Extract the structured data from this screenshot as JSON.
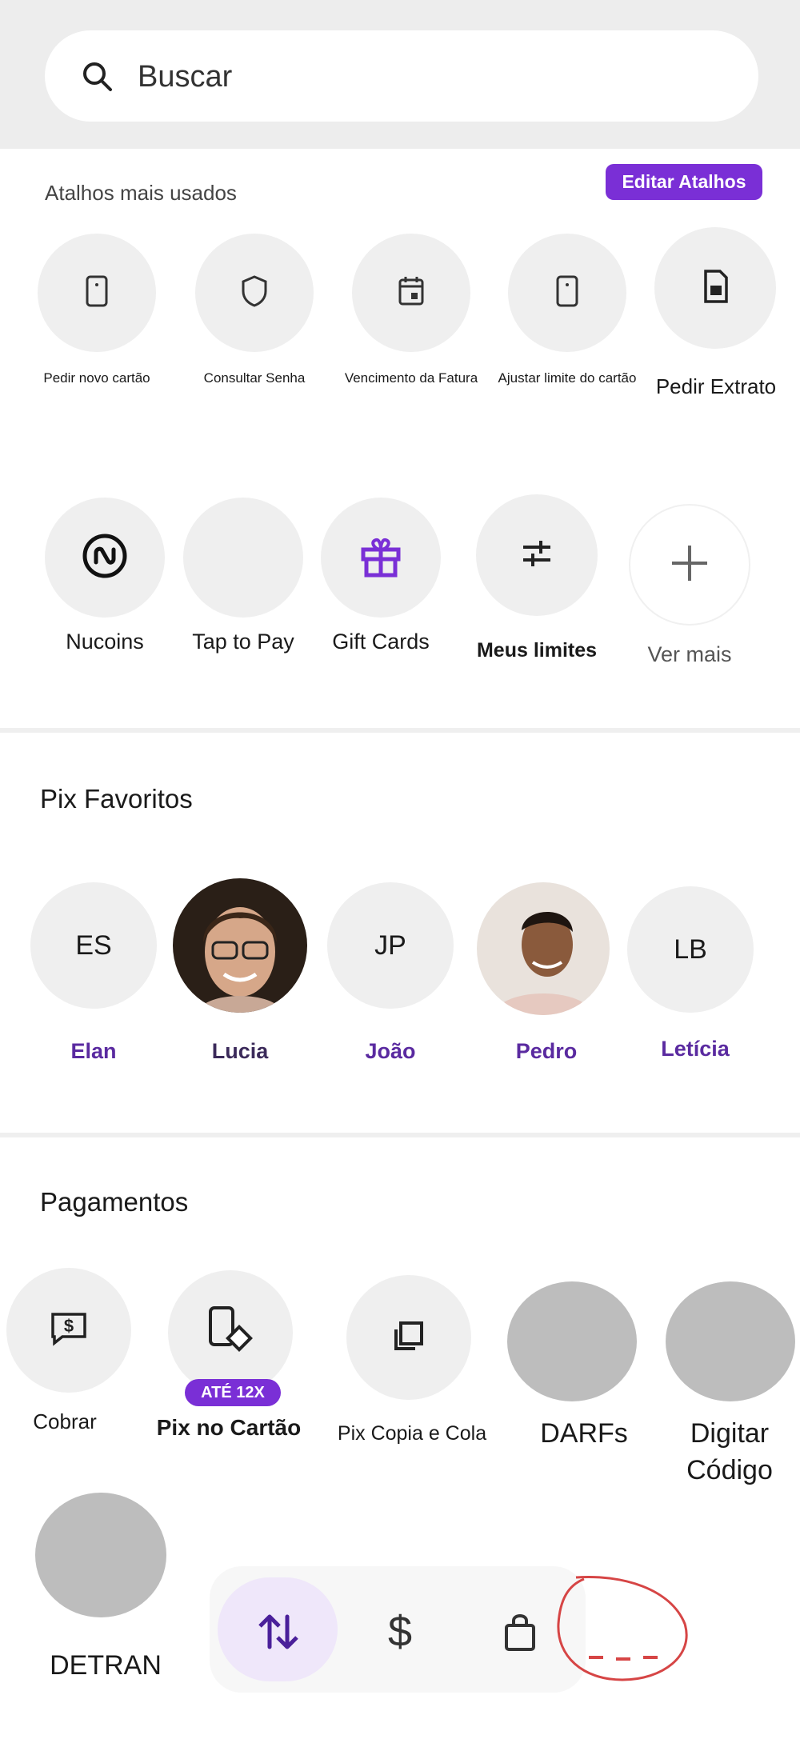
{
  "search": {
    "placeholder": "Buscar"
  },
  "shortcuts": {
    "title": "Atalhos mais usados",
    "edit_label": "Editar Atalhos",
    "row1": [
      {
        "label": "Pedir novo cartão",
        "icon": "card-icon"
      },
      {
        "label": "Consultar Senha",
        "icon": "shield-icon"
      },
      {
        "label": "Vencimento da Fatura",
        "icon": "calendar-icon"
      },
      {
        "label": "Ajustar limite do cartão",
        "icon": "card-icon"
      },
      {
        "label": "Pedir Extrato",
        "icon": "document-icon"
      }
    ],
    "row2": [
      {
        "label": "Nucoins",
        "icon": "nucoin-icon"
      },
      {
        "label": "Tap to Pay",
        "icon": ""
      },
      {
        "label": "Gift Cards",
        "icon": "gift-icon"
      },
      {
        "label": "Meus limites",
        "icon": "sliders-icon"
      },
      {
        "label": "Ver mais",
        "icon": "plus-icon"
      }
    ]
  },
  "pix_favorites": {
    "title": "Pix Favoritos",
    "contacts": [
      {
        "initials": "ES",
        "name": "Elan"
      },
      {
        "initials": "",
        "name": "Lucia"
      },
      {
        "initials": "JP",
        "name": "João"
      },
      {
        "initials": "",
        "name": "Pedro"
      },
      {
        "initials": "LB",
        "name": "Letícia"
      }
    ]
  },
  "payments": {
    "title": "Pagamentos",
    "items": [
      {
        "label": "Cobrar",
        "icon": "dollar-chat-icon"
      },
      {
        "label": "Pix no Cartão",
        "icon": "phone-pix-icon",
        "badge": "ATÉ 12X"
      },
      {
        "label": "Pix Copia e Cola",
        "icon": "copy-icon"
      },
      {
        "label": "DARFs",
        "icon": ""
      },
      {
        "label": "Digitar Código",
        "icon": ""
      },
      {
        "label": "DETRAN",
        "icon": ""
      }
    ]
  },
  "bottom_nav": {
    "items": [
      "transfer-arrows-icon",
      "dollar-icon",
      "shopping-bag-icon"
    ],
    "active": "transfer-arrows-icon"
  },
  "colors": {
    "accent": "#7a2fd6",
    "accent_text": "#5a2aa0",
    "circle_bg": "#efefef"
  }
}
